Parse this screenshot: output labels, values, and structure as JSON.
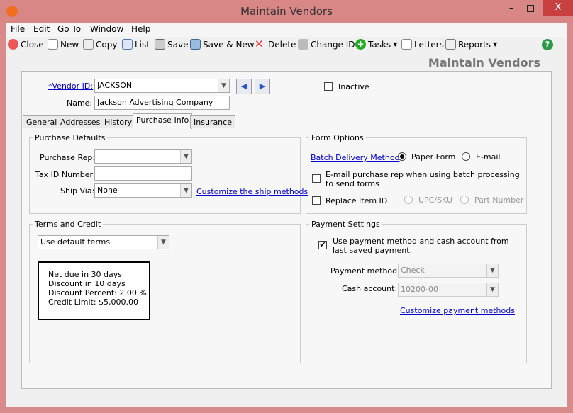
{
  "window": {
    "title": "Maintain Vendors",
    "close": "X"
  },
  "menu": [
    "File",
    "Edit",
    "Go To",
    "Window",
    "Help"
  ],
  "toolbar": {
    "close": "Close",
    "new": "New",
    "copy": "Copy",
    "list": "List",
    "save": "Save",
    "save_new": "Save & New",
    "delete": "Delete",
    "change_id": "Change ID",
    "tasks": "Tasks",
    "letters": "Letters",
    "reports": "Reports",
    "help": "?"
  },
  "header": "Maintain Vendors",
  "vendor": {
    "id_label": "*Vendor ID:",
    "id": "JACKSON",
    "name_label": "Name:",
    "name": "Jackson Advertising Company",
    "inactive": "Inactive",
    "inactive_checked": false
  },
  "tabs": [
    "General",
    "Addresses",
    "History",
    "Purchase Info",
    "Insurance"
  ],
  "active_tab": "Purchase Info",
  "purchase_defaults": {
    "title": "Purchase Defaults",
    "rep_label": "Purchase Rep:",
    "rep": "",
    "tax_label": "Tax ID Number:",
    "tax": "",
    "ship_label": "Ship Via:",
    "ship": "None",
    "ship_link": "Customize the ship methods"
  },
  "terms": {
    "title": "Terms and Credit",
    "select": "Use default terms",
    "lines": [
      "Net due in 30 days",
      "Discount in 10 days",
      "Discount Percent: 2.00 %",
      "Credit Limit: $5,000.00"
    ]
  },
  "form_options": {
    "title": "Form Options",
    "batch_label": "Batch Delivery Method",
    "paper": "Paper Form",
    "email": "E-mail",
    "selected": "Paper Form",
    "email_rep": "E-mail purchase rep when using batch processing to send forms",
    "replace": "Replace Item ID",
    "upc": "UPC/SKU",
    "part": "Part Number"
  },
  "payment": {
    "title": "Payment Settings",
    "use_last": "Use payment method and cash account from last saved payment.",
    "use_last_checked": true,
    "method_label": "Payment method:",
    "method": "Check",
    "cash_label": "Cash account:",
    "cash": "10200-00",
    "link": "Customize payment methods"
  }
}
